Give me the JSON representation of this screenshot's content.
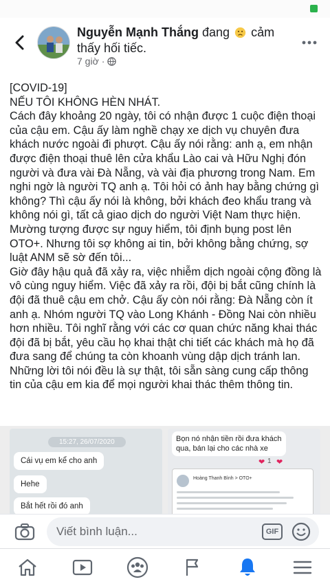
{
  "author": {
    "name": "Nguyễn Mạnh Thắng",
    "feeling_prefix": "đang",
    "feeling_emoji": "sad-face-icon",
    "feeling_text": "cảm thấy hối tiếc.",
    "timestamp": "7 giờ",
    "privacy": "globe-icon"
  },
  "post": {
    "paragraphs": [
      "[COVID-19]",
      "NẾU TÔI KHÔNG HÈN NHÁT.",
      "Cách đây khoảng 20 ngày, tôi có nhận được 1 cuộc điện thoại của cậu em. Cậu ấy làm nghề chạy xe dịch vụ chuyên đưa khách nước ngoài đi phượt. Cậu ấy nói rằng: anh ạ, em nhận được điện thoại thuê lên cửa khẩu Lào cai và Hữu Nghị đón người và đưa vài Đà Nẵng, và vài địa phương trong Nam. Em nghi ngờ là người TQ anh ạ. Tôi hỏi có ảnh hay bằng chứng gì không? Thì cậu ấy nói là không, bởi khách đeo khẩu trang và không nói gì, tất cả giao dịch do người Việt Nam thực hiện. Mường tượng được sự nguy hiểm, tôi định bụng post lên OTO+. Nhưng tôi sợ không ai tin, bởi không bằng chứng, sợ luật ANM sẽ sờ đến tôi...",
      "Giờ đây hậu quả đã xảy ra, việc nhiễm dịch ngoài cộng đồng là vô cùng nguy hiểm. Việc đã xảy ra rồi, đội bị bắt cũng chính là đội đã thuê cậu em chở. Cậu ấy còn nói rằng: Đà Nẵng còn ít anh ạ. Nhóm người TQ vào Long Khánh - Đồng Nai còn nhiều hơn nhiều. Tôi nghĩ rằng với các cơ quan chức năng khai thác đội đã bị bắt, yêu cầu họ khai thật chi tiết các khách mà họ đã đưa sang để chúng ta còn khoanh vùng dập dịch tránh lan.",
      "Những lời tôi nói đều là sự thật, tôi sẵn sàng cung cấp thông tin của cậu em kia để mọi người khai thác thêm thông tin."
    ]
  },
  "photo_left": {
    "date": "15:27, 26/07/2020",
    "messages": [
      "Cái vụ em kể cho anh",
      "Hehe",
      "Bắt hết rồi đó anh"
    ]
  },
  "photo_right": {
    "message": "Bọn nó nhận tiền rồi đưa khách qua, bán lại cho các nhà xe",
    "reaction": "❤",
    "reaction_count": "1",
    "mini_author": "Hoàng Thanh Bình > OTO+"
  },
  "comment_bar": {
    "placeholder": "Viết bình luận...",
    "gif_label": "GIF"
  },
  "nav": [
    "home-icon",
    "watch-icon",
    "groups-icon",
    "pages-flag-icon",
    "notifications-bell-icon",
    "menu-icon"
  ],
  "colors": {
    "accent": "#1877f2",
    "text": "#1c1e21",
    "secondary": "#65676b"
  }
}
